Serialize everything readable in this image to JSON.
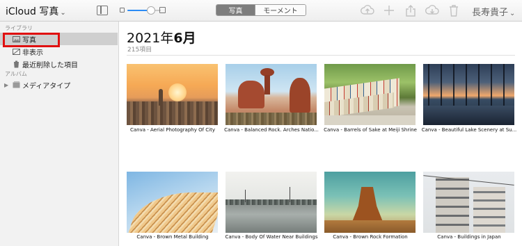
{
  "toolbar": {
    "app_name": "iCloud",
    "app_section": "写真",
    "caret": "⌄",
    "zoom_level": 0.7,
    "segments": [
      "写真",
      "モーメント"
    ],
    "selected_segment": "写真",
    "actions": [
      {
        "name": "upload-icon",
        "glyph": "☁"
      },
      {
        "name": "add-icon",
        "glyph": "+"
      },
      {
        "name": "share-icon",
        "glyph": "⇪"
      },
      {
        "name": "download-icon",
        "glyph": "☁"
      },
      {
        "name": "trash-icon",
        "glyph": "🗑"
      }
    ],
    "user_name": "長寿貴子",
    "user_caret": "⌄"
  },
  "sidebar": {
    "library_header": "ライブラリ",
    "library_items": [
      {
        "label": "写真",
        "icon": "photos-icon",
        "selected": true
      },
      {
        "label": "非表示",
        "icon": "hidden-icon",
        "selected": false
      },
      {
        "label": "最近削除した項目",
        "icon": "trash-icon",
        "selected": false
      }
    ],
    "albums_header": "アルバム",
    "album_items": [
      {
        "label": "メディアタイプ",
        "icon": "folder-icon",
        "expand": "▶"
      }
    ],
    "highlight_color": "#e01010"
  },
  "main": {
    "month_prefix": "2021年",
    "month_bold": "6月",
    "item_count": "215項目",
    "photos": [
      {
        "caption": "Canva - Aerial Photography Of City"
      },
      {
        "caption": "Canva - Balanced Rock. Arches Natio..."
      },
      {
        "caption": "Canva - Barrels of Sake at Meiji Shrine"
      },
      {
        "caption": "Canva - Beautiful Lake Scenery at Su..."
      },
      {
        "caption": "Canva - Brown Metal Building"
      },
      {
        "caption": "Canva - Body Of Water Near Buildings"
      },
      {
        "caption": "Canva - Brown Rock Formation"
      },
      {
        "caption": "Canva - Buildings in Japan"
      }
    ]
  }
}
